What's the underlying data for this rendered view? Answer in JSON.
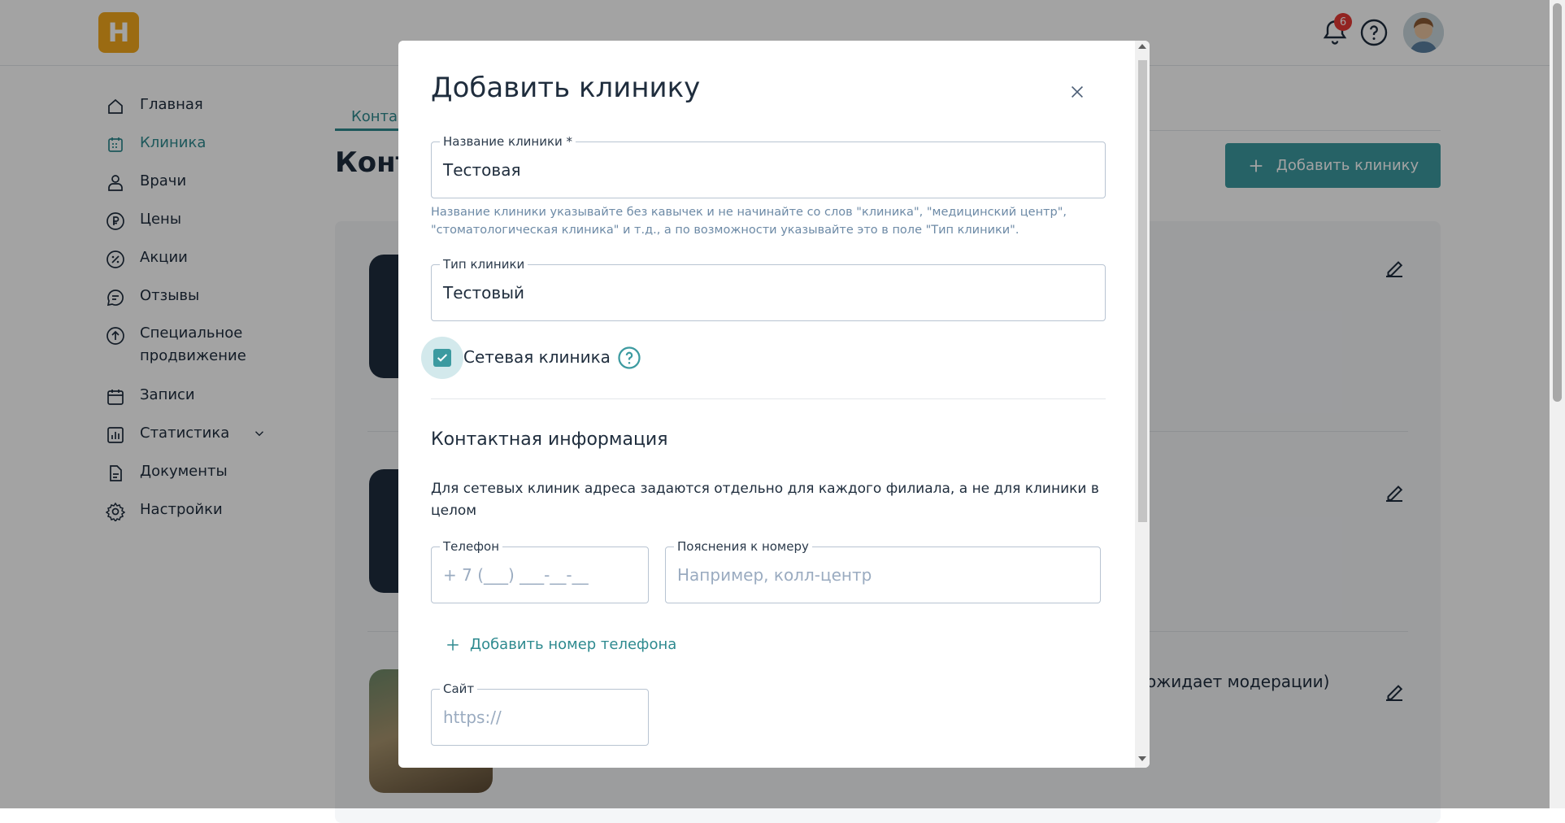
{
  "topbar": {
    "logo_letter": "H",
    "notifications_count": "6",
    "icons": {
      "bell": "bell-icon",
      "help": "help-circle-icon",
      "avatar": "user-avatar"
    }
  },
  "sidebar": {
    "items": [
      {
        "label": "Главная",
        "icon": "home-icon",
        "active": false
      },
      {
        "label": "Клиника",
        "icon": "clinic-calendar-icon",
        "active": true
      },
      {
        "label": "Врачи",
        "icon": "doctor-icon",
        "active": false
      },
      {
        "label": "Цены",
        "icon": "ruble-icon",
        "active": false
      },
      {
        "label": "Акции",
        "icon": "percent-icon",
        "active": false
      },
      {
        "label": "Отзывы",
        "icon": "chat-icon",
        "active": false
      },
      {
        "label": "Специальное продвижение",
        "icon": "arrow-up-circle-icon",
        "active": false
      },
      {
        "label": "Записи",
        "icon": "calendar-icon",
        "active": false
      },
      {
        "label": "Статистика",
        "icon": "bar-chart-icon",
        "active": false
      },
      {
        "label": "Документы",
        "icon": "document-icon",
        "active": false
      },
      {
        "label": "Настройки",
        "icon": "gear-icon",
        "active": false
      }
    ]
  },
  "main": {
    "tab_label": "Конта",
    "heading": "Конт",
    "add_button_label": "Добавить клинику",
    "moderation_text": "ожидает модерации)"
  },
  "modal": {
    "title": "Добавить клинику",
    "clinic_name": {
      "label": "Название клиники *",
      "value": "Тестовая"
    },
    "clinic_name_hint": "Название клиники указывайте без кавычек и не начинайте со слов \"клиника\", \"медицинский центр\", \"стоматологическая клиника\" и т.д., а по возможности указывайте это в поле \"Тип клиники\".",
    "clinic_type": {
      "label": "Тип клиники",
      "value": "Тестовый"
    },
    "network_checkbox": {
      "label": "Сетевая клиника",
      "checked": true
    },
    "contact_section_title": "Контактная информация",
    "contact_note": "Для сетевых клиник адреса задаются отдельно для каждого филиала, а не для клиники в целом",
    "phone": {
      "label": "Телефон",
      "placeholder": "+ 7 (___) ___-__-__"
    },
    "phone_note": {
      "label": "Пояснения к номеру",
      "placeholder": "Например, колл-центр"
    },
    "add_phone_label": "Добавить номер телефона",
    "site": {
      "label": "Сайт",
      "placeholder": "https://"
    }
  },
  "colors": {
    "accent": "#3c9aa0",
    "logo": "#f2a81d",
    "badge": "#e53935",
    "hint_text": "#6d8aa6",
    "dark_text": "#1f2d3d"
  }
}
